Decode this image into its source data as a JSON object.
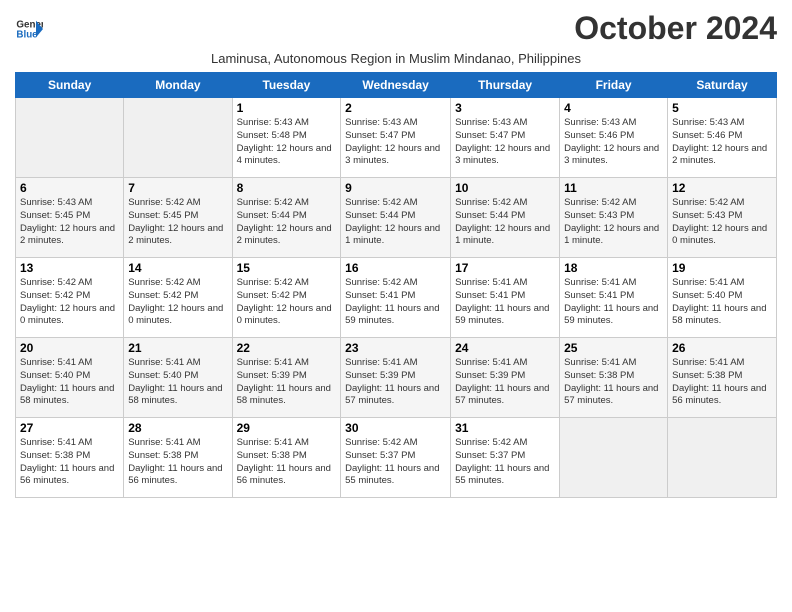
{
  "header": {
    "logo_line1": "General",
    "logo_line2": "Blue",
    "month_title": "October 2024",
    "subtitle": "Laminusa, Autonomous Region in Muslim Mindanao, Philippines"
  },
  "calendar": {
    "days_of_week": [
      "Sunday",
      "Monday",
      "Tuesday",
      "Wednesday",
      "Thursday",
      "Friday",
      "Saturday"
    ],
    "weeks": [
      [
        {
          "day": "",
          "sunrise": "",
          "sunset": "",
          "daylight": ""
        },
        {
          "day": "",
          "sunrise": "",
          "sunset": "",
          "daylight": ""
        },
        {
          "day": "1",
          "sunrise": "Sunrise: 5:43 AM",
          "sunset": "Sunset: 5:48 PM",
          "daylight": "Daylight: 12 hours and 4 minutes."
        },
        {
          "day": "2",
          "sunrise": "Sunrise: 5:43 AM",
          "sunset": "Sunset: 5:47 PM",
          "daylight": "Daylight: 12 hours and 3 minutes."
        },
        {
          "day": "3",
          "sunrise": "Sunrise: 5:43 AM",
          "sunset": "Sunset: 5:47 PM",
          "daylight": "Daylight: 12 hours and 3 minutes."
        },
        {
          "day": "4",
          "sunrise": "Sunrise: 5:43 AM",
          "sunset": "Sunset: 5:46 PM",
          "daylight": "Daylight: 12 hours and 3 minutes."
        },
        {
          "day": "5",
          "sunrise": "Sunrise: 5:43 AM",
          "sunset": "Sunset: 5:46 PM",
          "daylight": "Daylight: 12 hours and 2 minutes."
        }
      ],
      [
        {
          "day": "6",
          "sunrise": "Sunrise: 5:43 AM",
          "sunset": "Sunset: 5:45 PM",
          "daylight": "Daylight: 12 hours and 2 minutes."
        },
        {
          "day": "7",
          "sunrise": "Sunrise: 5:42 AM",
          "sunset": "Sunset: 5:45 PM",
          "daylight": "Daylight: 12 hours and 2 minutes."
        },
        {
          "day": "8",
          "sunrise": "Sunrise: 5:42 AM",
          "sunset": "Sunset: 5:44 PM",
          "daylight": "Daylight: 12 hours and 2 minutes."
        },
        {
          "day": "9",
          "sunrise": "Sunrise: 5:42 AM",
          "sunset": "Sunset: 5:44 PM",
          "daylight": "Daylight: 12 hours and 1 minute."
        },
        {
          "day": "10",
          "sunrise": "Sunrise: 5:42 AM",
          "sunset": "Sunset: 5:44 PM",
          "daylight": "Daylight: 12 hours and 1 minute."
        },
        {
          "day": "11",
          "sunrise": "Sunrise: 5:42 AM",
          "sunset": "Sunset: 5:43 PM",
          "daylight": "Daylight: 12 hours and 1 minute."
        },
        {
          "day": "12",
          "sunrise": "Sunrise: 5:42 AM",
          "sunset": "Sunset: 5:43 PM",
          "daylight": "Daylight: 12 hours and 0 minutes."
        }
      ],
      [
        {
          "day": "13",
          "sunrise": "Sunrise: 5:42 AM",
          "sunset": "Sunset: 5:42 PM",
          "daylight": "Daylight: 12 hours and 0 minutes."
        },
        {
          "day": "14",
          "sunrise": "Sunrise: 5:42 AM",
          "sunset": "Sunset: 5:42 PM",
          "daylight": "Daylight: 12 hours and 0 minutes."
        },
        {
          "day": "15",
          "sunrise": "Sunrise: 5:42 AM",
          "sunset": "Sunset: 5:42 PM",
          "daylight": "Daylight: 12 hours and 0 minutes."
        },
        {
          "day": "16",
          "sunrise": "Sunrise: 5:42 AM",
          "sunset": "Sunset: 5:41 PM",
          "daylight": "Daylight: 11 hours and 59 minutes."
        },
        {
          "day": "17",
          "sunrise": "Sunrise: 5:41 AM",
          "sunset": "Sunset: 5:41 PM",
          "daylight": "Daylight: 11 hours and 59 minutes."
        },
        {
          "day": "18",
          "sunrise": "Sunrise: 5:41 AM",
          "sunset": "Sunset: 5:41 PM",
          "daylight": "Daylight: 11 hours and 59 minutes."
        },
        {
          "day": "19",
          "sunrise": "Sunrise: 5:41 AM",
          "sunset": "Sunset: 5:40 PM",
          "daylight": "Daylight: 11 hours and 58 minutes."
        }
      ],
      [
        {
          "day": "20",
          "sunrise": "Sunrise: 5:41 AM",
          "sunset": "Sunset: 5:40 PM",
          "daylight": "Daylight: 11 hours and 58 minutes."
        },
        {
          "day": "21",
          "sunrise": "Sunrise: 5:41 AM",
          "sunset": "Sunset: 5:40 PM",
          "daylight": "Daylight: 11 hours and 58 minutes."
        },
        {
          "day": "22",
          "sunrise": "Sunrise: 5:41 AM",
          "sunset": "Sunset: 5:39 PM",
          "daylight": "Daylight: 11 hours and 58 minutes."
        },
        {
          "day": "23",
          "sunrise": "Sunrise: 5:41 AM",
          "sunset": "Sunset: 5:39 PM",
          "daylight": "Daylight: 11 hours and 57 minutes."
        },
        {
          "day": "24",
          "sunrise": "Sunrise: 5:41 AM",
          "sunset": "Sunset: 5:39 PM",
          "daylight": "Daylight: 11 hours and 57 minutes."
        },
        {
          "day": "25",
          "sunrise": "Sunrise: 5:41 AM",
          "sunset": "Sunset: 5:38 PM",
          "daylight": "Daylight: 11 hours and 57 minutes."
        },
        {
          "day": "26",
          "sunrise": "Sunrise: 5:41 AM",
          "sunset": "Sunset: 5:38 PM",
          "daylight": "Daylight: 11 hours and 56 minutes."
        }
      ],
      [
        {
          "day": "27",
          "sunrise": "Sunrise: 5:41 AM",
          "sunset": "Sunset: 5:38 PM",
          "daylight": "Daylight: 11 hours and 56 minutes."
        },
        {
          "day": "28",
          "sunrise": "Sunrise: 5:41 AM",
          "sunset": "Sunset: 5:38 PM",
          "daylight": "Daylight: 11 hours and 56 minutes."
        },
        {
          "day": "29",
          "sunrise": "Sunrise: 5:41 AM",
          "sunset": "Sunset: 5:38 PM",
          "daylight": "Daylight: 11 hours and 56 minutes."
        },
        {
          "day": "30",
          "sunrise": "Sunrise: 5:42 AM",
          "sunset": "Sunset: 5:37 PM",
          "daylight": "Daylight: 11 hours and 55 minutes."
        },
        {
          "day": "31",
          "sunrise": "Sunrise: 5:42 AM",
          "sunset": "Sunset: 5:37 PM",
          "daylight": "Daylight: 11 hours and 55 minutes."
        },
        {
          "day": "",
          "sunrise": "",
          "sunset": "",
          "daylight": ""
        },
        {
          "day": "",
          "sunrise": "",
          "sunset": "",
          "daylight": ""
        }
      ]
    ]
  }
}
